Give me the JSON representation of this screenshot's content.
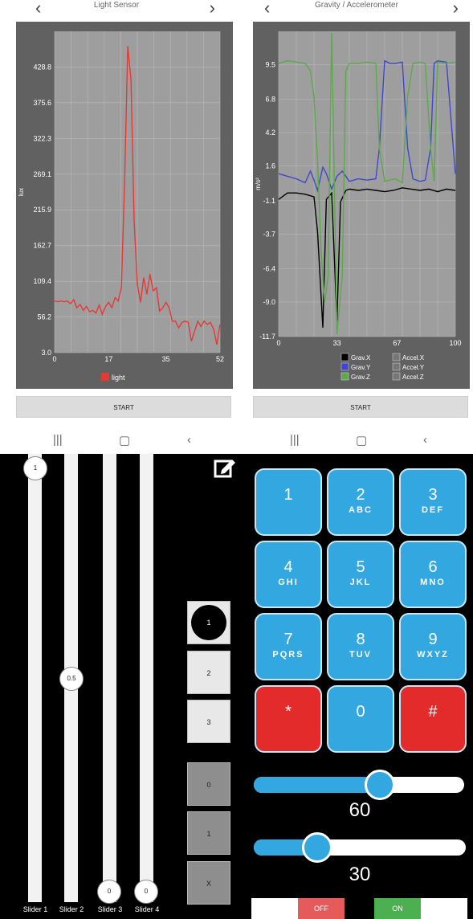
{
  "colors": {
    "chart_bg": "#616161",
    "grid": "#7c7c7c",
    "light": "#e53935",
    "grav_x": "#000000",
    "grav_y": "#3f48cc",
    "grav_z": "#5aaa4a",
    "key_blue": "#33a8e0",
    "key_red": "#e32b2b",
    "toggle_off": "#e55a5a",
    "toggle_on": "#4caf50"
  },
  "screens": {
    "left": {
      "title": "Light Sensor",
      "prev_icon": "chevron-left-icon",
      "next_icon": "chevron-right-icon",
      "start_label": "START",
      "chart_data": {
        "type": "line",
        "ylabel": "lux",
        "y_ticks": [
          "428.8",
          "375.6",
          "322.3",
          "269.1",
          "215.9",
          "162.7",
          "109.4",
          "56.2",
          "3.0"
        ],
        "x_ticks": [
          "0",
          "17",
          "35",
          "52"
        ],
        "xlim": [
          0,
          52
        ],
        "ylim": [
          3.0,
          482
        ],
        "legend": [
          "light"
        ],
        "series": [
          {
            "name": "light",
            "x": [
              0,
              1,
              2,
              3,
              4,
              5,
              6,
              7,
              8,
              9,
              10,
              11,
              12,
              13,
              14,
              15,
              16,
              17,
              18,
              19,
              20,
              21,
              22,
              23,
              24,
              25,
              26,
              27,
              28,
              29,
              30,
              31,
              32,
              33,
              34,
              35,
              36,
              37,
              38,
              39,
              40,
              41,
              42,
              43,
              44,
              45,
              46,
              47,
              48,
              49,
              50,
              51,
              52
            ],
            "y": [
              80,
              79,
              80,
              79,
              80,
              76,
              82,
              70,
              75,
              66,
              72,
              64,
              66,
              62,
              74,
              60,
              72,
              78,
              70,
              85,
              80,
              100,
              260,
              460,
              410,
              200,
              105,
              78,
              115,
              90,
              120,
              95,
              100,
              65,
              70,
              78,
              70,
              50,
              50,
              40,
              48,
              50,
              48,
              20,
              35,
              50,
              42,
              50,
              45,
              48,
              38,
              15,
              45
            ]
          }
        ]
      }
    },
    "right": {
      "title": "Gravity / Accelerometer",
      "prev_icon": "chevron-left-icon",
      "next_icon": "chevron-right-icon",
      "start_label": "START",
      "chart_data": {
        "type": "line",
        "ylabel": "m/s²",
        "y_ticks": [
          "9.5",
          "6.8",
          "4.2",
          "1.6",
          "-1.1",
          "-3.7",
          "-6.4",
          "-9.0",
          "-11.7"
        ],
        "x_ticks": [
          "0",
          "33",
          "67",
          "100"
        ],
        "xlim": [
          0,
          100
        ],
        "ylim": [
          -11.7,
          12.1
        ],
        "legend": [
          "Grav.X",
          "Accel.X",
          "Grav.Y",
          "Accel.Y",
          "Grav.Z",
          "Accel.Z"
        ],
        "series": [
          {
            "name": "Grav.X",
            "x": [
              0,
              5,
              10,
              15,
              20,
              22,
              25,
              27,
              30,
              33,
              35,
              38,
              40,
              45,
              50,
              55,
              60,
              65,
              70,
              75,
              80,
              85,
              90,
              95,
              100
            ],
            "y": [
              -1.0,
              -0.5,
              -0.5,
              -0.6,
              -0.8,
              -3.5,
              -11.0,
              -1.0,
              -0.5,
              -10.5,
              -1.2,
              -0.3,
              -0.2,
              -0.3,
              -0.2,
              -0.3,
              -0.4,
              -0.3,
              -0.1,
              -0.2,
              -0.3,
              -0.2,
              -0.4,
              -0.2,
              -0.3
            ]
          },
          {
            "name": "Grav.Y",
            "x": [
              0,
              5,
              10,
              15,
              18,
              20,
              22,
              25,
              27,
              30,
              33,
              36,
              40,
              45,
              50,
              55,
              57,
              60,
              63,
              66,
              70,
              73,
              76,
              80,
              83,
              86,
              88,
              90,
              95,
              100
            ],
            "y": [
              1.0,
              0.8,
              0.6,
              0.3,
              1.2,
              0.5,
              -0.3,
              1.5,
              1.0,
              -0.2,
              0.8,
              1.2,
              0.4,
              0.6,
              0.5,
              0.6,
              3.0,
              9.8,
              9.6,
              9.6,
              9.7,
              3.0,
              0.6,
              0.4,
              0.5,
              3.0,
              9.6,
              9.8,
              9.7,
              1.0
            ]
          },
          {
            "name": "Grav.Z",
            "x": [
              0,
              5,
              10,
              15,
              18,
              20,
              22,
              24,
              26,
              28,
              30,
              33,
              36,
              38,
              40,
              45,
              50,
              55,
              57,
              60,
              63,
              66,
              70,
              73,
              76,
              80,
              83,
              86,
              88,
              90,
              95,
              100
            ],
            "y": [
              9.6,
              9.8,
              9.7,
              9.6,
              9.0,
              7.0,
              2.0,
              -5.0,
              -9.0,
              -7.0,
              12.0,
              -11.5,
              -7.0,
              9.0,
              9.6,
              9.6,
              9.7,
              9.6,
              3.0,
              0.4,
              0.5,
              0.6,
              0.3,
              7.0,
              9.6,
              9.7,
              9.6,
              3.0,
              0.4,
              9.7,
              9.6,
              9.7
            ]
          }
        ]
      }
    }
  },
  "sysbar": {
    "recents_icon": "recents-icon",
    "home_icon": "home-icon",
    "back_icon": "back-icon"
  },
  "controller": {
    "sliders": [
      {
        "label": "Slider 1",
        "value": "1"
      },
      {
        "label": "Slider 2",
        "value": "0.5"
      },
      {
        "label": "Slider 3",
        "value": "0"
      },
      {
        "label": "Slider 4",
        "value": "0"
      }
    ],
    "edit_icon": "edit-icon",
    "buttons_top": [
      "1",
      "2",
      "3"
    ],
    "buttons_bottom": [
      "0",
      "1",
      "X"
    ],
    "keypad": [
      {
        "num": "1",
        "letters": "",
        "color": "blue"
      },
      {
        "num": "2",
        "letters": "ABC",
        "color": "blue"
      },
      {
        "num": "3",
        "letters": "DEF",
        "color": "blue"
      },
      {
        "num": "4",
        "letters": "GHI",
        "color": "blue"
      },
      {
        "num": "5",
        "letters": "JKL",
        "color": "blue"
      },
      {
        "num": "6",
        "letters": "MNO",
        "color": "blue"
      },
      {
        "num": "7",
        "letters": "PQRS",
        "color": "blue"
      },
      {
        "num": "8",
        "letters": "TUV",
        "color": "blue"
      },
      {
        "num": "9",
        "letters": "WXYZ",
        "color": "blue"
      },
      {
        "num": "*",
        "letters": "",
        "color": "red"
      },
      {
        "num": "0",
        "letters": "",
        "color": "blue"
      },
      {
        "num": "#",
        "letters": "",
        "color": "red"
      }
    ],
    "h_slider_1": {
      "value": "60",
      "fraction": 0.6
    },
    "h_slider_2": {
      "value": "30",
      "fraction": 0.3
    },
    "toggle_1": {
      "off_label": "OFF"
    },
    "toggle_2": {
      "on_label": "ON"
    }
  }
}
